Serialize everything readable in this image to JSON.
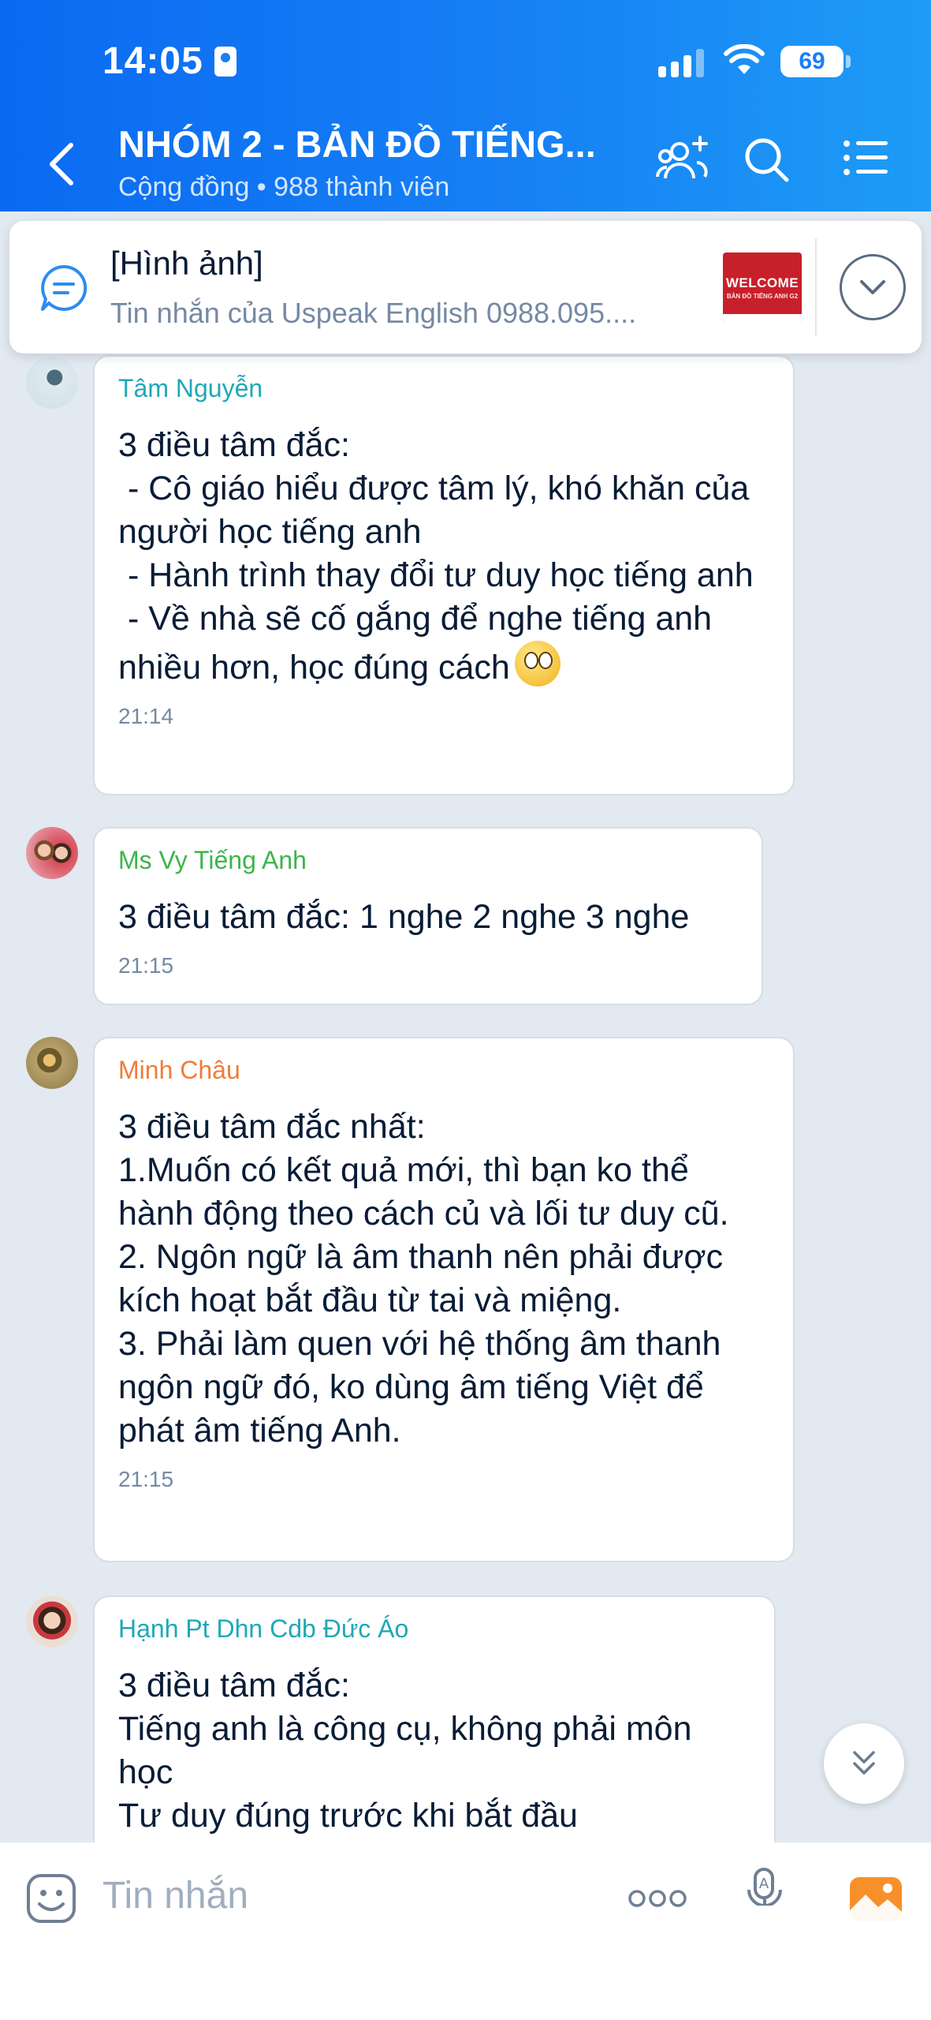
{
  "status_bar": {
    "time": "14:05",
    "battery": "69"
  },
  "header": {
    "title": "NHÓM 2 - BẢN ĐỒ TIẾNG...",
    "subtitle": "Cộng đồng • 988 thành viên"
  },
  "pinned": {
    "title": "[Hình ảnh]",
    "subtitle": "Tin nhắn của Uspeak English 0988.095....",
    "thumb_text": "WELCOME",
    "thumb_sub": "BẢN ĐỒ TIẾNG ANH G2"
  },
  "messages": [
    {
      "sender": "Tâm Nguyễn",
      "sender_color": "#1fa8b8",
      "text": "3 điều tâm đắc:\n - Cô giáo hiểu được tâm lý, khó khăn của người học tiếng anh\n - Hành trình thay đổi tư duy học tiếng anh\n - Về nhà sẽ cố gắng để nghe tiếng anh nhiều hơn, học đúng cách",
      "time": "21:14"
    },
    {
      "sender": "Ms Vy Tiếng Anh",
      "sender_color": "#3cb54a",
      "text": "3 điều tâm đắc: 1 nghe 2 nghe 3 nghe",
      "time": "21:15"
    },
    {
      "sender": "Minh Châu",
      "sender_color": "#f07c3a",
      "text": "3 điều tâm đắc nhất:\n1.Muốn có kết quả mới, thì bạn ko thể hành động theo cách củ và lối tư duy cũ.\n2. Ngôn ngữ là âm thanh nên phải được kích hoạt bắt đầu từ tai và miệng.\n3. Phải làm quen với hệ thống âm thanh ngôn ngữ đó, ko dùng âm tiếng Việt để phát âm tiếng Anh.",
      "time": "21:15"
    },
    {
      "sender": "Hạnh Pt Dhn Cdb Đức Áo",
      "sender_color": "#1fa8b8",
      "text": "3 điều tâm đắc:\nTiếng anh là công cụ, không phải môn học\nTư duy đúng trước khi bắt đầu",
      "time": ""
    }
  ],
  "input": {
    "placeholder": "Tin nhắn"
  },
  "colors": {
    "header": "#1680f4",
    "chat_bg": "#e2e9f1",
    "bubble": "#ffffff"
  },
  "icons": [
    "back-icon",
    "add-member-icon",
    "search-icon",
    "menu-icon",
    "pinned-message-icon",
    "chevron-down-icon",
    "scroll-down-icon",
    "sticker-icon",
    "more-icon",
    "voice-icon",
    "image-icon"
  ]
}
